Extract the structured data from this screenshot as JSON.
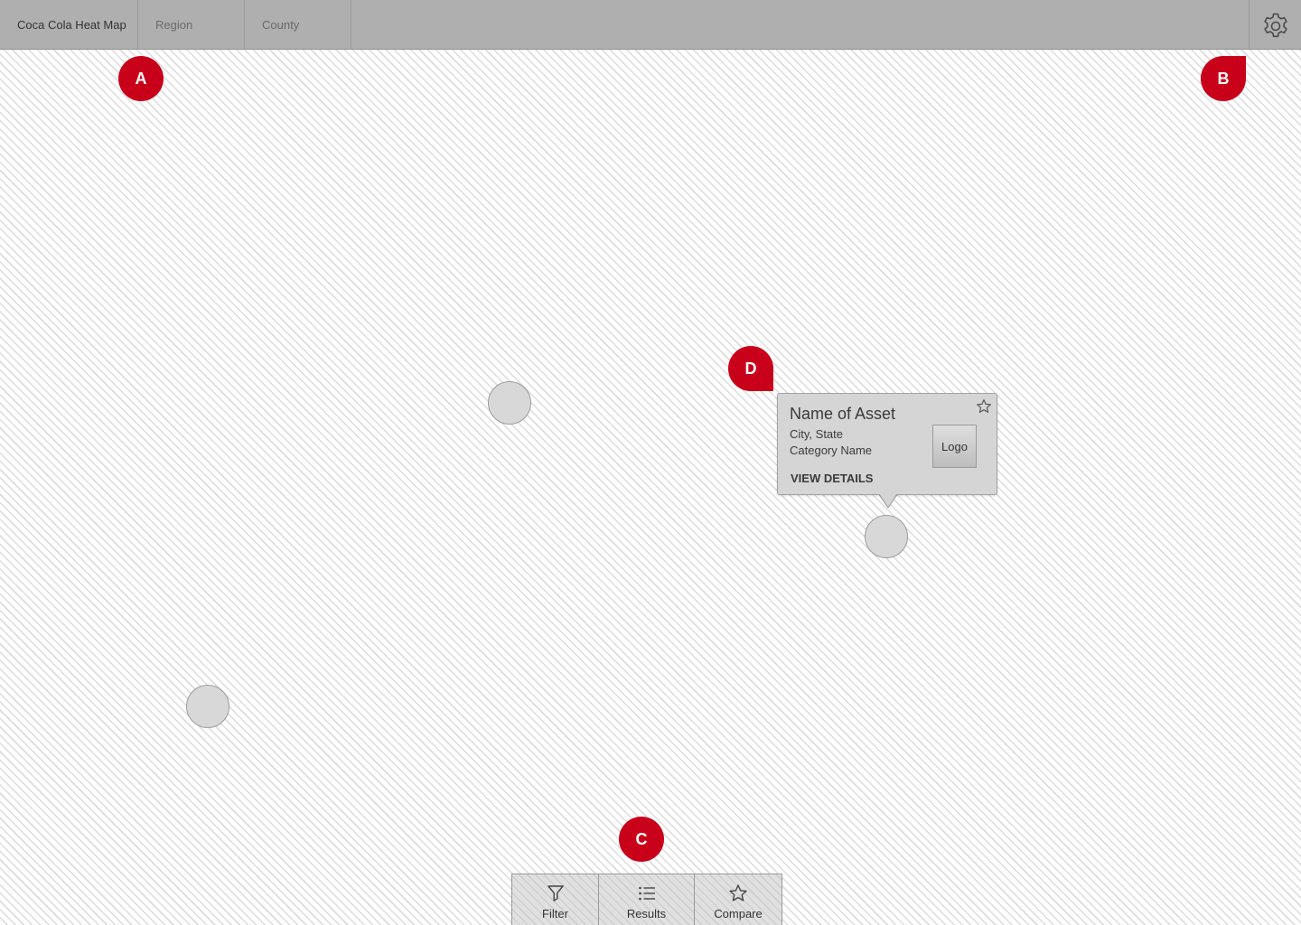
{
  "header": {
    "app_title": "Coca Cola Heat Map",
    "crumbs": [
      "Region",
      "County"
    ],
    "settings_icon": "gear-icon"
  },
  "markers": {
    "a": "A",
    "b": "B",
    "c": "C",
    "d": "D"
  },
  "popup": {
    "title": "Name of Asset",
    "location": "City, State",
    "category": "Category Name",
    "logo_label": "Logo",
    "link_label": "VIEW DETAILS",
    "favorite_icon": "star-icon"
  },
  "toolbar": {
    "items": [
      {
        "label": "Filter",
        "icon": "filter-icon"
      },
      {
        "label": "Results",
        "icon": "list-icon"
      },
      {
        "label": "Compare",
        "icon": "star-icon"
      }
    ]
  },
  "colors": {
    "marker": "#c8001a",
    "topbar": "#b0afaf",
    "pin": "#d8d8d8",
    "popup": "#d5d5d5"
  }
}
